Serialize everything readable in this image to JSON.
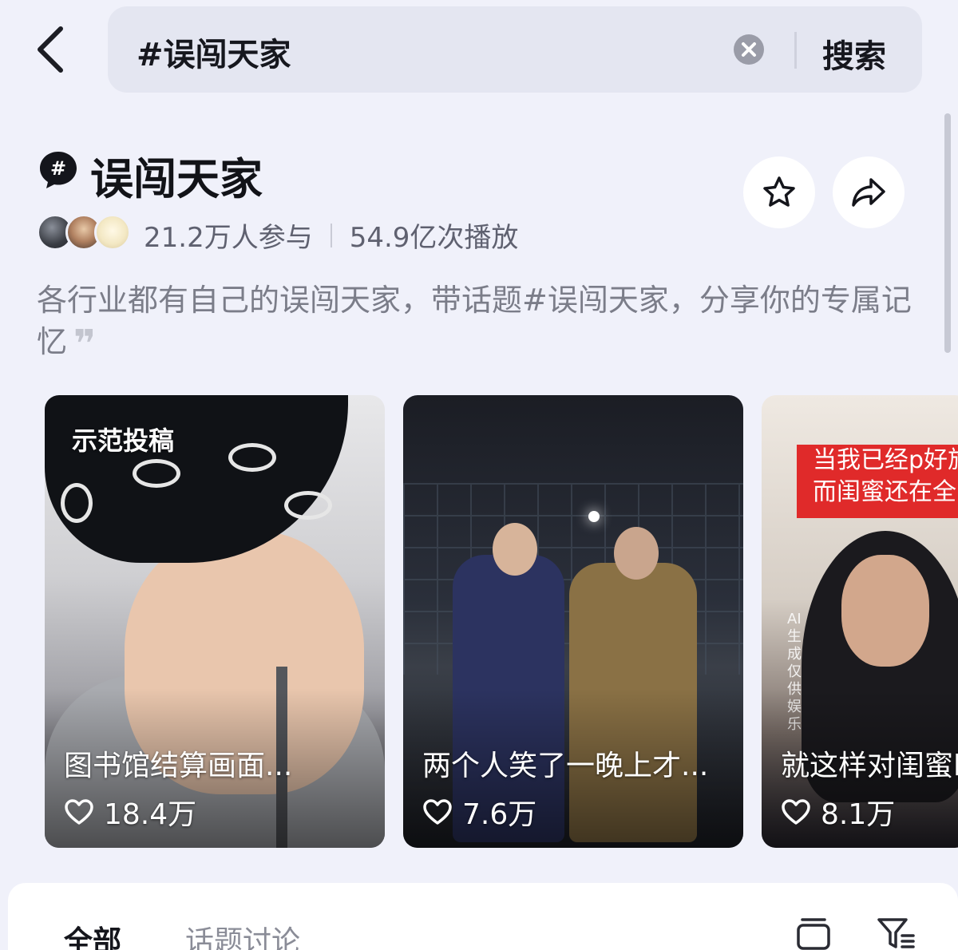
{
  "search": {
    "query": "#误闯天家",
    "button_label": "搜索"
  },
  "topic": {
    "title": "误闯天家",
    "participants": "21.2万人参与",
    "plays": "54.9亿次播放",
    "description": "各行业都有自己的误闯天家，带话题#误闯天家，分享你的专属记忆",
    "quote_mark": "❞"
  },
  "cards": [
    {
      "badge": "示范投稿",
      "title": "图书馆结算画面...",
      "likes": "18.4万"
    },
    {
      "badge": "",
      "title": "两个人笑了一晚上才...",
      "likes": "7.6万"
    },
    {
      "badge": "",
      "title": "就这样对闺蜜l",
      "likes": "8.1万",
      "sign_line1": "当我已经p好旅",
      "sign_line2": "而闺蜜还在全",
      "ai_label": "AI生成 仅供娱乐"
    }
  ],
  "tabs": [
    {
      "label": "全部"
    },
    {
      "label": "话题讨论"
    }
  ],
  "icons": {
    "back": "back-arrow-icon",
    "clear": "clear-icon",
    "topic": "hashtag-bubble-icon",
    "favorite": "star-icon",
    "share": "share-arrow-icon",
    "like": "heart-icon",
    "layout": "layout-icon",
    "filter": "filter-icon"
  },
  "colors": {
    "background": "#f0f1fa",
    "search_bg": "#e4e6f1",
    "text_primary": "#121318",
    "text_secondary": "#7b7d89",
    "sign_red": "#e02a2a"
  }
}
